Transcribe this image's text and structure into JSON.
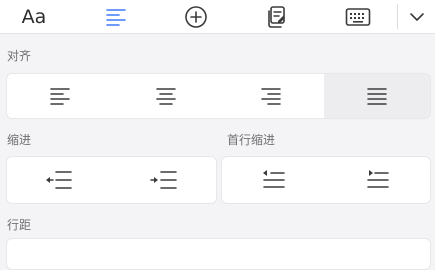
{
  "toolbar": {
    "font_label": "Aa",
    "items": [
      {
        "icon": "font-style-icon"
      },
      {
        "icon": "paragraph-align-icon",
        "active": true
      },
      {
        "icon": "insert-plus-icon"
      },
      {
        "icon": "clipboard-edit-icon"
      },
      {
        "icon": "keyboard-icon"
      },
      {
        "icon": "chevron-down-icon"
      }
    ],
    "active_color": "#3e7bfa"
  },
  "sections": {
    "alignment": {
      "label": "对齐",
      "options": [
        "align-left-icon",
        "align-center-icon",
        "align-right-icon",
        "align-justify-icon"
      ],
      "selected": "align-justify-icon"
    },
    "indent": {
      "label": "缩进",
      "options": [
        "decrease-indent-icon",
        "increase-indent-icon"
      ]
    },
    "first_line_indent": {
      "label": "首行缩进",
      "options": [
        "first-line-outdent-icon",
        "first-line-indent-icon"
      ]
    },
    "line_spacing": {
      "label": "行距"
    }
  }
}
